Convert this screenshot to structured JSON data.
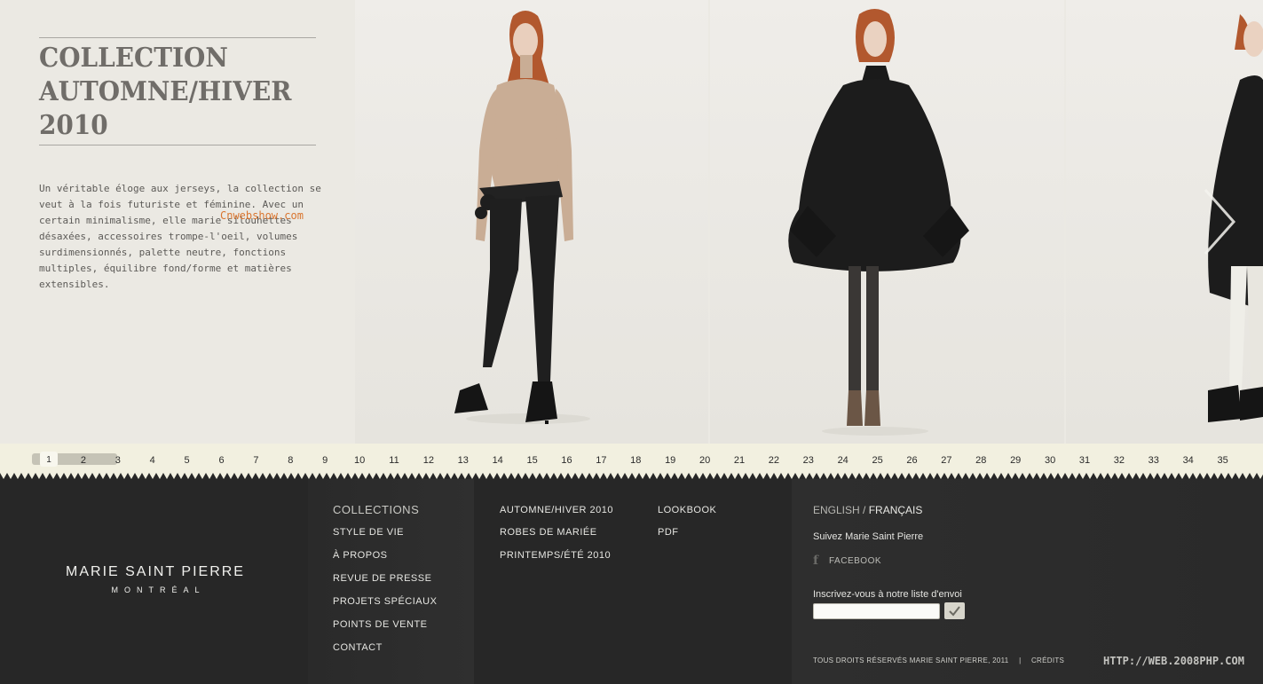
{
  "intro": {
    "title_line1": "COLLECTION",
    "title_line2": "AUTOMNE/HIVER",
    "title_line3": "2010",
    "description": "Un véritable éloge aux jerseys, la collection se veut à la fois futuriste et féminine. Avec un certain minimalisme, elle marie silouhettes désaxées, accessoires trompe-l'oeil, volumes surdimensionnés, palette neutre, fonctions multiples, équilibre fond/forme et matières extensibles.",
    "watermark": "Cnwebshow.com"
  },
  "gallery": {
    "next_icon": "chevron-right-icon"
  },
  "pager": {
    "current": 1,
    "pages": [
      "1",
      "2",
      "3",
      "4",
      "5",
      "6",
      "7",
      "8",
      "9",
      "10",
      "11",
      "12",
      "13",
      "14",
      "15",
      "16",
      "17",
      "18",
      "19",
      "20",
      "21",
      "22",
      "23",
      "24",
      "25",
      "26",
      "27",
      "28",
      "29",
      "30",
      "31",
      "32",
      "33",
      "34",
      "35"
    ]
  },
  "footer": {
    "brand_name": "MARIE SAINT PIERRE",
    "brand_city": "MONTRÉAL",
    "menu_main": [
      "COLLECTIONS",
      "STYLE DE VIE",
      "À PROPOS",
      "REVUE DE PRESSE",
      "PROJETS SPÉCIAUX",
      "POINTS DE VENTE",
      "CONTACT"
    ],
    "menu_collections": [
      "AUTOMNE/HIVER 2010",
      "ROBES DE MARIÉE",
      "PRINTEMPS/ÉTÉ 2010"
    ],
    "menu_media": [
      "LOOKBOOK",
      "PDF"
    ],
    "lang_en": "ENGLISH",
    "lang_sep": "/",
    "lang_fr": "FRANÇAIS",
    "follow_text": "Suivez Marie Saint Pierre",
    "facebook_label": "FACEBOOK",
    "signup_text": "Inscrivez-vous à notre liste d'envoi",
    "email_value": "",
    "copyright": "TOUS DROITS RÉSERVÉS MARIE SAINT PIERRE, 2011",
    "copyright_sep": "|",
    "credits": "CRÉDITS",
    "watermark": "HTTP://WEB.2008PHP.COM"
  },
  "colors": {
    "page_bg": "#ebe9e3",
    "footer_bg": "#272727",
    "pager_bg": "#f2f0e0",
    "accent_watermark": "#d9752f"
  }
}
